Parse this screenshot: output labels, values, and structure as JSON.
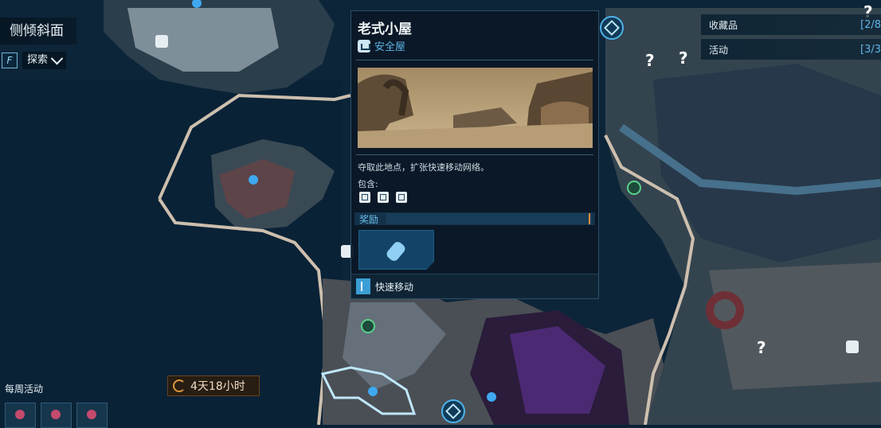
{
  "region": {
    "title": "侧倾斜面"
  },
  "explore": {
    "key": "F",
    "label": "探索"
  },
  "stats": [
    {
      "label": "收藏品",
      "value": "[2/8"
    },
    {
      "label": "活动",
      "value": "[3/3"
    }
  ],
  "popup": {
    "title": "老式小屋",
    "subtitle": "安全屋",
    "description": "夺取此地点，扩张快速移动网络。",
    "contains_label": "包含:",
    "reward_label": "奖励",
    "footer_label": "快速移动"
  },
  "weekly": {
    "label": "每周活动",
    "timer": "4天18小时"
  },
  "colors": {
    "accent": "#5fb5e8",
    "panel": "#0a1826",
    "timer_bg": "#2d1c0c",
    "purple_glow": "#7b3fd6"
  },
  "icons": [
    "map-pin-icon",
    "question-mark-icon",
    "fast-travel-icon",
    "safehouse-icon",
    "timer-icon"
  ]
}
